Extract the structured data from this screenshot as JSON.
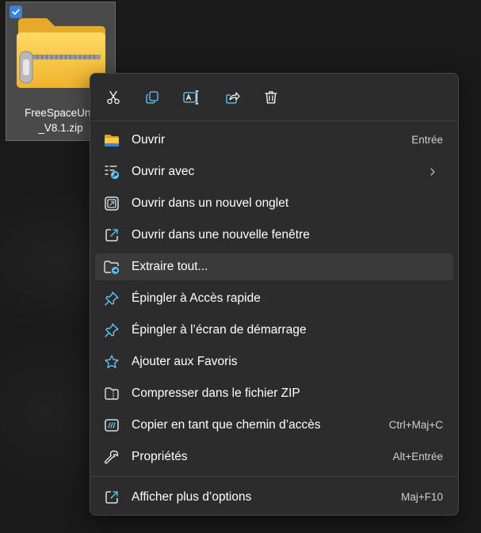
{
  "file": {
    "name": "FreeSpaceUno\n_V8.1.zip",
    "selected": true
  },
  "toolbar": {
    "cut": "scissors-icon",
    "copy": "copy-icon",
    "rename": "rename-icon",
    "share": "share-icon",
    "delete": "trash-icon"
  },
  "menu": {
    "items": [
      {
        "label": "Ouvrir",
        "shortcut": "Entrée",
        "icon": "folder-icon"
      },
      {
        "label": "Ouvrir avec",
        "shortcut": "",
        "icon": "open-with-icon",
        "submenu": true
      },
      {
        "label": "Ouvrir dans un nouvel onglet",
        "shortcut": "",
        "icon": "new-tab-icon"
      },
      {
        "label": "Ouvrir dans une nouvelle fenêtre",
        "shortcut": "",
        "icon": "new-window-icon"
      },
      {
        "label": "Extraire tout...",
        "shortcut": "",
        "icon": "extract-icon",
        "hovered": true
      },
      {
        "label": "Épingler à Accès rapide",
        "shortcut": "",
        "icon": "pin-icon"
      },
      {
        "label": "Épingler à l’écran de démarrage",
        "shortcut": "",
        "icon": "pin-icon"
      },
      {
        "label": "Ajouter aux Favoris",
        "shortcut": "",
        "icon": "star-icon"
      },
      {
        "label": "Compresser dans le fichier ZIP",
        "shortcut": "",
        "icon": "zip-icon"
      },
      {
        "label": "Copier en tant que chemin d’accès",
        "shortcut": "Ctrl+Maj+C",
        "icon": "copy-path-icon"
      },
      {
        "label": "Propriétés",
        "shortcut": "Alt+Entrée",
        "icon": "wrench-icon"
      },
      {
        "label": "Afficher plus d’options",
        "shortcut": "Maj+F10",
        "icon": "more-options-icon"
      }
    ]
  },
  "colors": {
    "accent": "#60cdff",
    "menu_bg": "#2c2c2c",
    "folder_yellow": "#f5c542"
  }
}
